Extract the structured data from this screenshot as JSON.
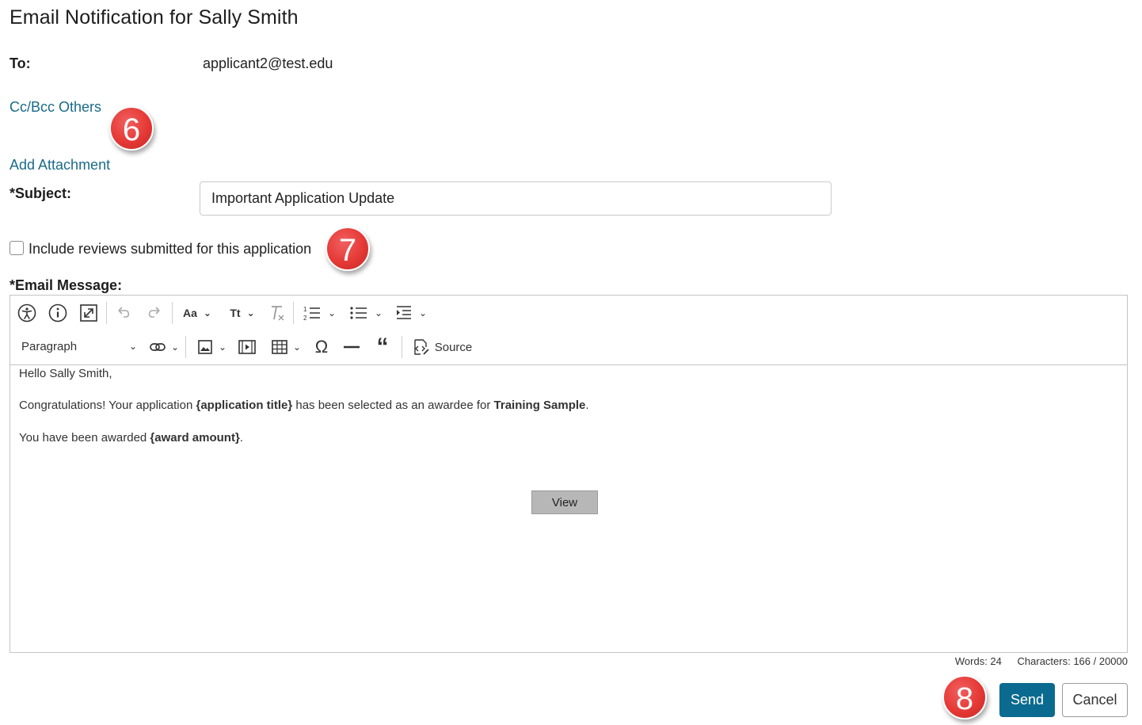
{
  "page": {
    "title": "Email Notification for Sally Smith"
  },
  "to": {
    "label": "To:",
    "value": "applicant2@test.edu"
  },
  "links": {
    "cc_bcc": "Cc/Bcc Others",
    "add_attachment": "Add Attachment"
  },
  "subject": {
    "label": "*Subject:",
    "value": "Important Application Update"
  },
  "include_reviews": {
    "label": "Include reviews submitted for this application",
    "checked": false
  },
  "email_message": {
    "label": "*Email Message:"
  },
  "toolbar": {
    "font_family_label": "Aa",
    "font_size_label": "Tt",
    "paragraph_label": "Paragraph",
    "source_label": "Source",
    "icons": [
      "accessibility-icon",
      "info-icon",
      "fullscreen-icon",
      "undo-icon",
      "redo-icon",
      "font-family-icon",
      "font-size-icon",
      "remove-format-icon",
      "numbered-list-icon",
      "bulleted-list-icon",
      "indent-icon",
      "link-icon",
      "image-icon",
      "media-icon",
      "table-icon",
      "special-characters-icon",
      "horizontal-line-icon",
      "blockquote-icon",
      "source-icon"
    ]
  },
  "body": {
    "greeting": "Hello Sally Smith,",
    "line1_pre": "Congratulations! Your application ",
    "line1_bold1": "{application title}",
    "line1_mid": " has been selected as an awardee for ",
    "line1_bold2": "Training Sample",
    "line1_end": ".",
    "line2_pre": "You have been awarded ",
    "line2_bold": "{award amount}",
    "line2_end": ".",
    "view_button": "View"
  },
  "counts": {
    "words": "Words: 24",
    "characters": "Characters: 166 / 20000"
  },
  "actions": {
    "send": "Send",
    "cancel": "Cancel"
  },
  "badges": [
    "6",
    "7",
    "8"
  ],
  "colors": {
    "link": "#1a6b8a",
    "primary_button": "#0b6a8f",
    "badge": "#e53935"
  }
}
